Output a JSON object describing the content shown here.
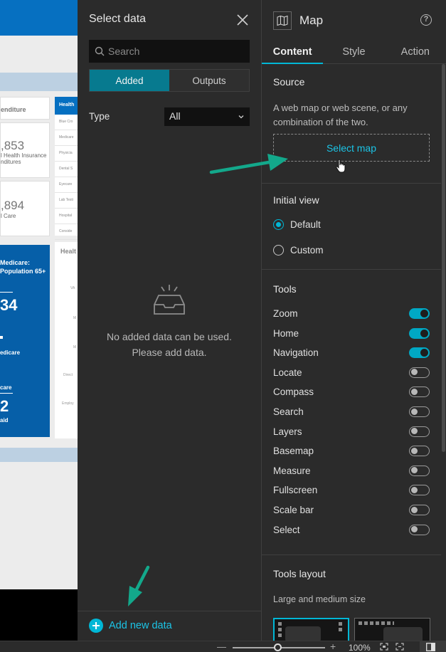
{
  "canvas_preview": {
    "texts": {
      "expenditure": "enditure",
      "num1": ",853",
      "lbl1a": "l Health Insurance",
      "lbl1b": "nditures",
      "num2": ",894",
      "lbl2": "l Care",
      "list_header": "Health",
      "medicare_a": "Medicare:",
      "medicare_b": "Population 65+",
      "bignum1": "34",
      "edicare": "edicare",
      "care": "care",
      "bignum2": "2",
      "aid": "aid",
      "chart_title": "Healt"
    },
    "list_rows": [
      "Blue Cro",
      "Medicare",
      "Physicia",
      "Dental S",
      "Eyecare",
      "Lab Testi",
      "Hospital",
      "Conside"
    ],
    "chart_labels": [
      "VA",
      "M",
      "M",
      "Direct",
      "Employ"
    ]
  },
  "select_data": {
    "title": "Select data",
    "search_placeholder": "Search",
    "tabs": {
      "added": "Added",
      "outputs": "Outputs"
    },
    "type_label": "Type",
    "type_value": "All",
    "empty_line1": "No added data can be used.",
    "empty_line2": "Please add data.",
    "add_new_data": "Add new data"
  },
  "map_panel": {
    "title": "Map",
    "help": "?",
    "tabs": {
      "content": "Content",
      "style": "Style",
      "action": "Action"
    },
    "source": {
      "heading": "Source",
      "description": "A web map or web scene, or any combination of the two.",
      "select_map": "Select map"
    },
    "initial_view": {
      "heading": "Initial view",
      "default": "Default",
      "custom": "Custom",
      "selected": "Default"
    },
    "tools": {
      "heading": "Tools",
      "items": [
        {
          "label": "Zoom",
          "on": true
        },
        {
          "label": "Home",
          "on": true
        },
        {
          "label": "Navigation",
          "on": true
        },
        {
          "label": "Locate",
          "on": false
        },
        {
          "label": "Compass",
          "on": false
        },
        {
          "label": "Search",
          "on": false
        },
        {
          "label": "Layers",
          "on": false
        },
        {
          "label": "Basemap",
          "on": false
        },
        {
          "label": "Measure",
          "on": false
        },
        {
          "label": "Fullscreen",
          "on": false
        },
        {
          "label": "Scale bar",
          "on": false
        },
        {
          "label": "Select",
          "on": false
        }
      ]
    },
    "tools_layout": {
      "heading": "Tools layout",
      "subheading": "Large and medium size"
    }
  },
  "status_bar": {
    "zoom_minus": "—",
    "zoom_plus": "+",
    "zoom_level": "100%"
  },
  "colors": {
    "accent": "#00b7d6",
    "accent_dark": "#077a8f",
    "arrow": "#13a88b",
    "panel_bg": "#2b2b2b"
  }
}
